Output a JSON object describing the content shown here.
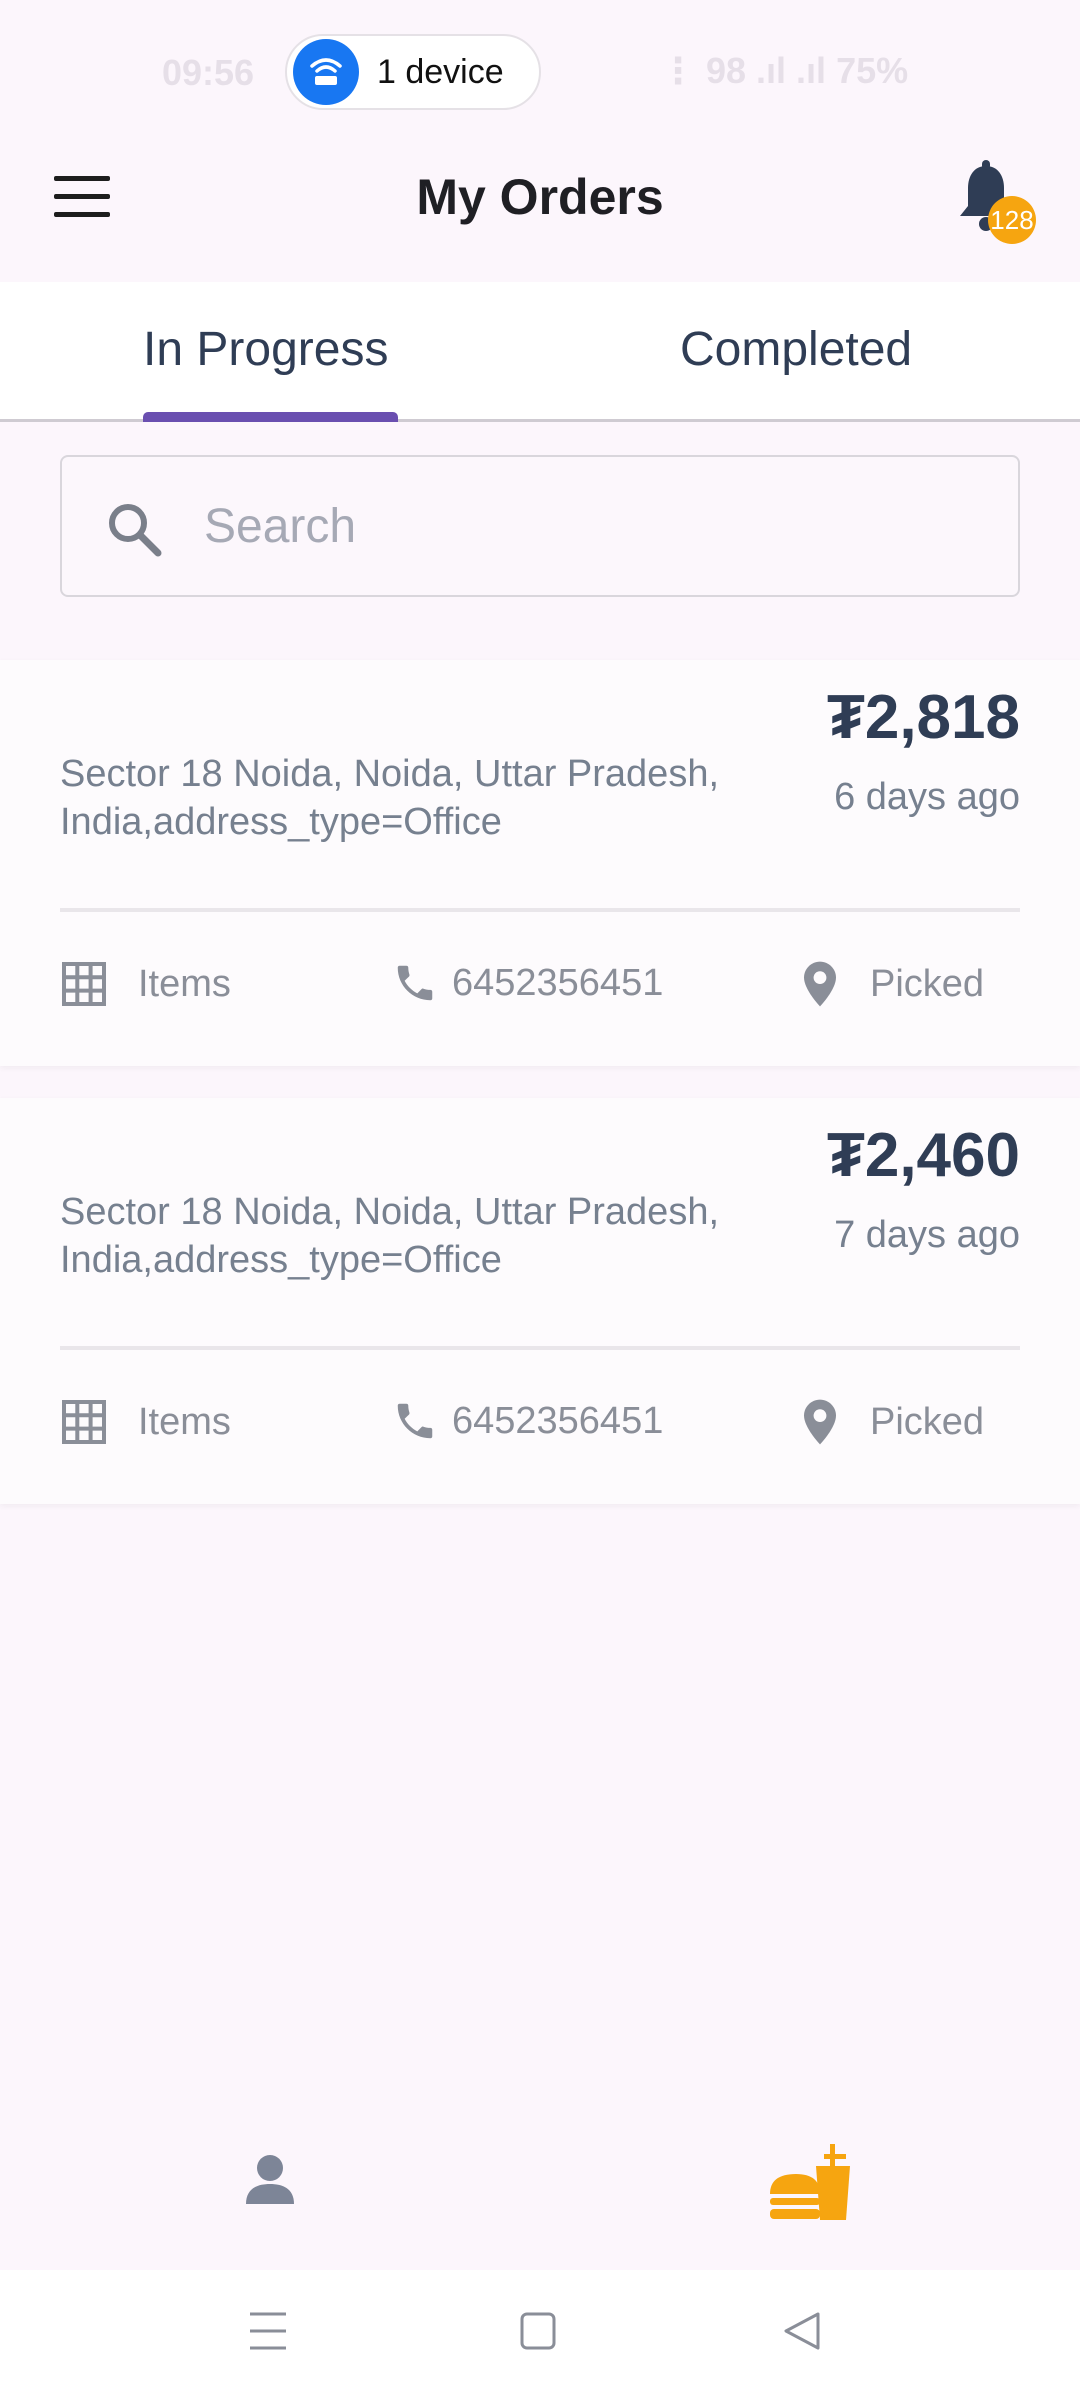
{
  "status_bar": {
    "time": "09:56",
    "right_text": "⋮ 98 .ıl .ıl 75%",
    "device_pill_label": "1 device"
  },
  "header": {
    "title": "My Orders",
    "notification_count": "128"
  },
  "tabs": [
    {
      "label": "In Progress",
      "active": true
    },
    {
      "label": "Completed",
      "active": false
    }
  ],
  "search": {
    "placeholder": "Search",
    "value": ""
  },
  "orders": [
    {
      "address": "Sector 18 Noida, Noida, Uttar Pradesh, India,address_type=Office",
      "price": "₮2,818",
      "time_ago": "6 days ago",
      "items_label": "Items",
      "phone": "6452356451",
      "status": "Picked"
    },
    {
      "address": "Sector 18 Noida, Noida, Uttar Pradesh, India,address_type=Office",
      "price": "₮2,460",
      "time_ago": "7 days ago",
      "items_label": "Items",
      "phone": "6452356451",
      "status": "Picked"
    }
  ],
  "colors": {
    "accent": "#6a4fb0",
    "badge": "#f6a510",
    "food_icon": "#f6a510"
  },
  "icons": {
    "menu": "menu-icon",
    "bell": "bell-icon",
    "search": "search-icon",
    "items": "grid-icon",
    "phone": "phone-icon",
    "status": "location-pin-icon",
    "profile": "person-icon",
    "food": "burger-drink-icon"
  }
}
